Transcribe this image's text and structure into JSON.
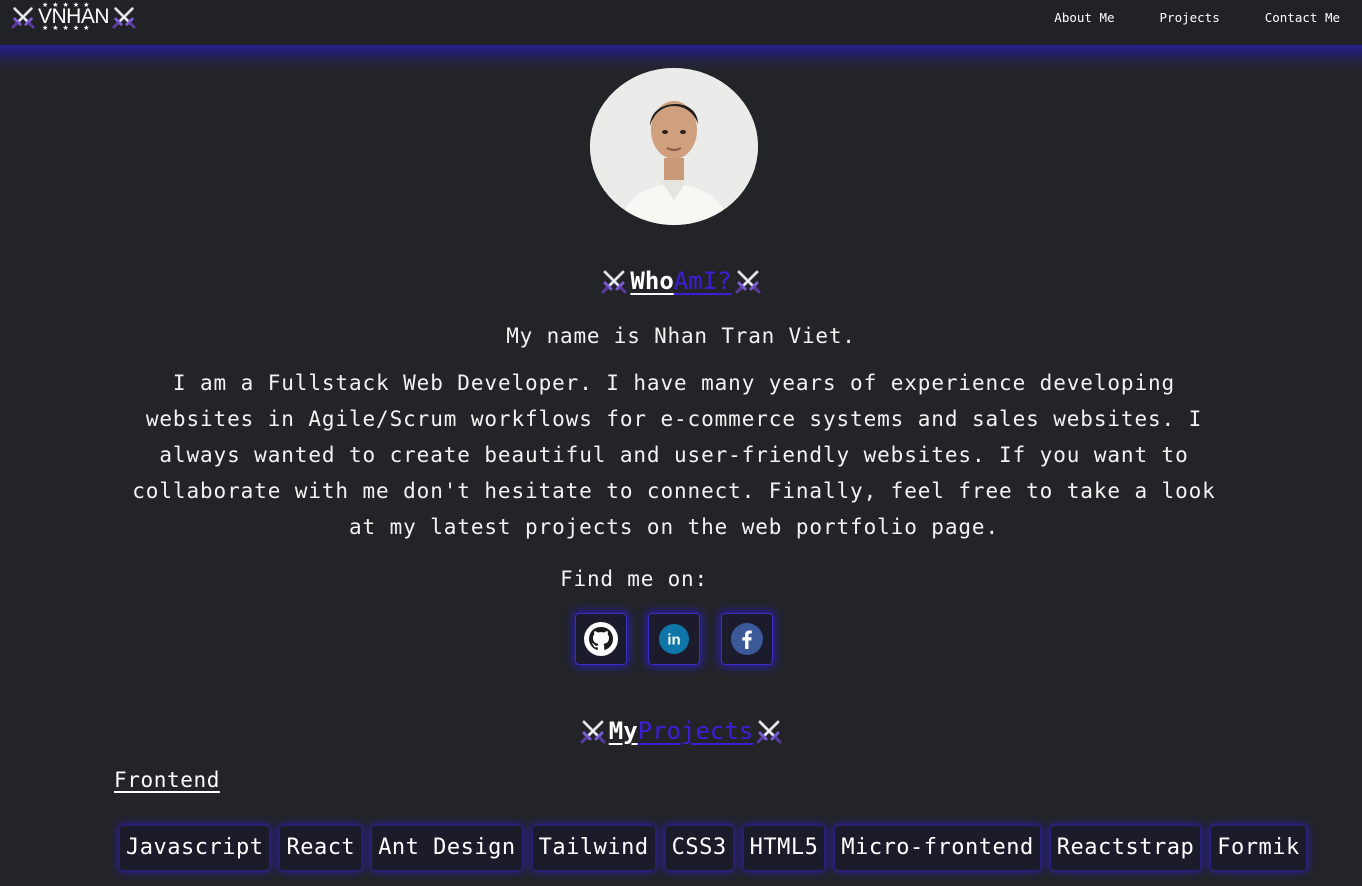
{
  "header": {
    "logo_text": "VNHAN",
    "logo_stars": "★★★★★",
    "nav": [
      "About Me",
      "Projects",
      "Contact Me"
    ]
  },
  "about": {
    "heading_part1": "Who",
    "heading_part2": "AmI?",
    "intro": "My name is Nhan Tran Viet.",
    "bio": "I am a Fullstack Web Developer. I have many years of experience developing websites in Agile/Scrum workflows for e-commerce systems and sales websites. I always wanted to create beautiful and user-friendly websites. If you want to collaborate with me don't hesitate to connect. Finally, feel free to take a look at my latest projects on the web portfolio page.",
    "find_me": "Find me on:",
    "social_icons": [
      "github-icon",
      "linkedin-icon",
      "facebook-icon"
    ]
  },
  "projects": {
    "heading_part1": "My",
    "heading_part2": "Projects",
    "section_label": "Frontend",
    "tags": [
      "Javascript",
      "React",
      "Ant Design",
      "Tailwind",
      "CSS3",
      "HTML5",
      "Micro-frontend",
      "Reactstrap",
      "Formik"
    ]
  },
  "colors": {
    "background": "#222428",
    "accent": "#3b1fd8",
    "glow": "#2c1fa8"
  }
}
